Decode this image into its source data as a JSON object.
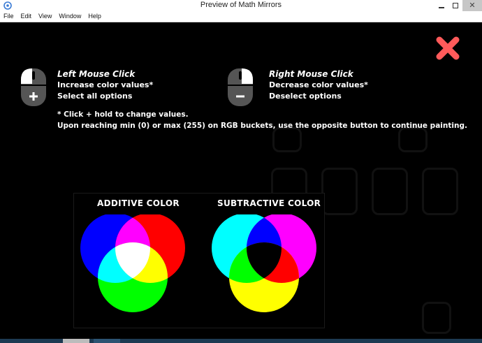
{
  "window": {
    "title": "Preview of Math Mirrors",
    "close_glyph": "✕"
  },
  "menu": [
    "File",
    "Edit",
    "View",
    "Window",
    "Help"
  ],
  "left_help": {
    "icon": "mouse-left-plus-icon",
    "title": "Left Mouse Click",
    "line1": "Increase color values*",
    "line2": "Select all options"
  },
  "right_help": {
    "icon": "mouse-right-minus-icon",
    "title": "Right Mouse Click",
    "line1": "Decrease color values*",
    "line2": "Deselect options"
  },
  "note": {
    "line1": "* Click + hold to change values.",
    "line2": "Upon reaching min (0) or max (255) on RGB buckets, use the opposite button to continue painting."
  },
  "additive": {
    "title": "ADDITIVE COLOR",
    "colors": {
      "c1": "#0000ff",
      "c2": "#ff0000",
      "c3": "#00ff00",
      "ov12": "#ff00ff",
      "ov13": "#00ffff",
      "ov23": "#ffff00",
      "center": "#ffffff"
    }
  },
  "subtractive": {
    "title": "SUBTRACTIVE COLOR",
    "colors": {
      "c1": "#00ffff",
      "c2": "#ff00ff",
      "c3": "#ffff00",
      "ov12": "#0000ff",
      "ov13": "#00ff00",
      "ov23": "#ff0000",
      "center": "#000000"
    }
  },
  "colors": {
    "close_button": "#ff5a5a",
    "background": "#000000"
  }
}
